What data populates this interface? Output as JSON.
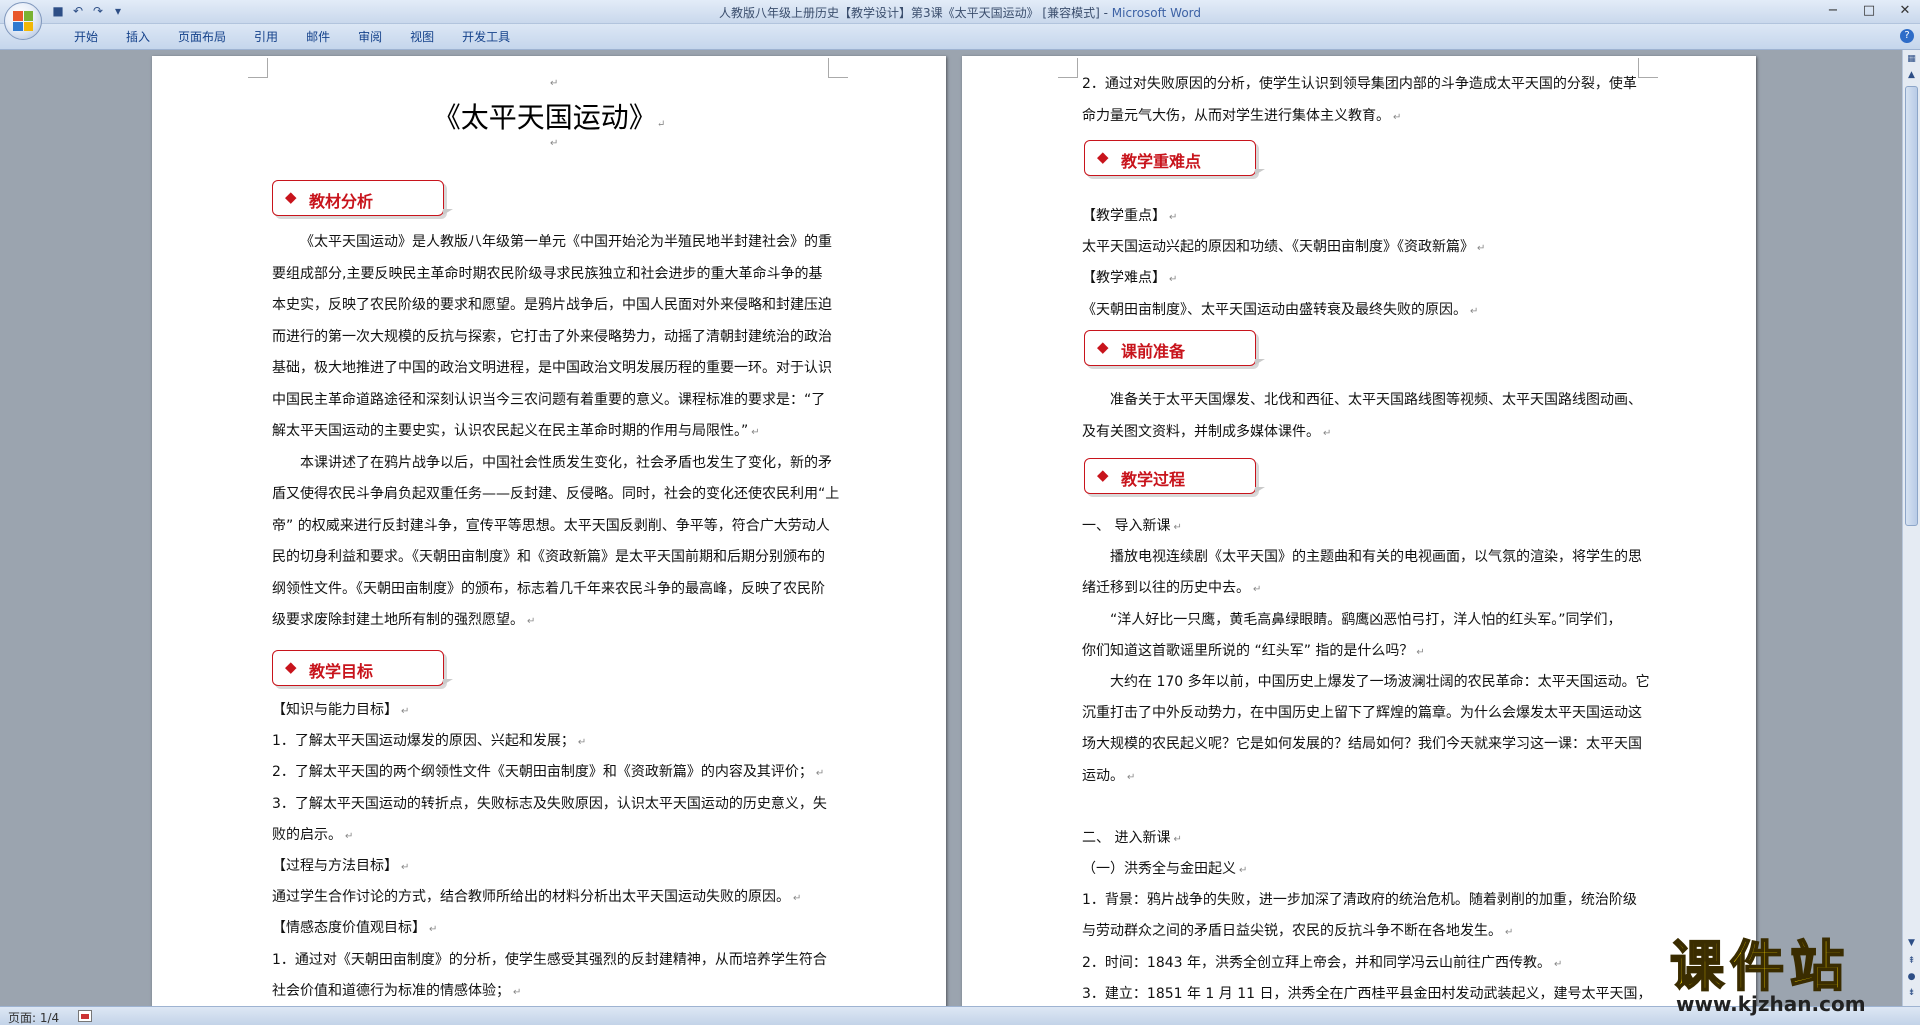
{
  "window": {
    "title_doc": "人教版八年级上册历史【教学设计】第3课《太平天国运动》 [兼容模式] - ",
    "title_app": "Microsoft Word",
    "minimize": "−",
    "maximize": "□",
    "close": "✕"
  },
  "quick_access": [
    "save-icon",
    "undo-icon",
    "redo-icon",
    "customize-icon"
  ],
  "ribbon": {
    "tabs": [
      "开始",
      "插入",
      "页面布局",
      "引用",
      "邮件",
      "审阅",
      "视图",
      "开发工具"
    ],
    "help": "?"
  },
  "page1": {
    "title": "《太平天国运动》",
    "section1": "教材分析",
    "section2": "教学目标",
    "lines": [
      "《太平天国运动》是人教版八年级第一单元《中国开始沦为半殖民地半封建社会》的重",
      "要组成部分,主要反映民主革命时期农民阶级寻求民族独立和社会进步的重大革命斗争的基",
      "本史实，反映了农民阶级的要求和愿望。是鸦片战争后，中国人民面对外来侵略和封建压迫",
      "而进行的第一次大规模的反抗与探索，它打击了外来侵略势力，动摇了清朝封建统治的政治",
      "基础，极大地推进了中国的政治文明进程，是中国政治文明发展历程的重要一环。对于认识",
      "中国民主革命道路途径和深刻认识当今三农问题有着重要的意义。课程标准的要求是：“了",
      "解太平天国运动的主要史实，认识农民起义在民主革命时期的作用与局限性。”",
      "本课讲述了在鸦片战争以后，中国社会性质发生变化，社会矛盾也发生了变化，新的矛",
      "盾又使得农民斗争肩负起双重任务——反封建、反侵略。同时，社会的变化还使农民利用“上",
      "帝” 的权威来进行反封建斗争，宣传平等思想。太平天国反剥削、争平等，符合广大劳动人",
      "民的切身利益和要求。《天朝田亩制度》和《资政新篇》是太平天国前期和后期分别颁布的",
      "纲领性文件。《天朝田亩制度》的颁布，标志着几千年来农民斗争的最高峰，反映了农民阶",
      "级要求废除封建土地所有制的强烈愿望。"
    ],
    "goals": [
      "【知识与能力目标】",
      "1．了解太平天国运动爆发的原因、兴起和发展；",
      "2．了解太平天国的两个纲领性文件《天朝田亩制度》和《资政新篇》的内容及其评价；",
      "3．了解太平天国运动的转折点，失败标志及失败原因，认识太平天国运动的历史意义，失",
      "败的启示。",
      "【过程与方法目标】",
      "通过学生合作讨论的方式，结合教师所给出的材料分析出太平天国运动失败的原因。",
      "【情感态度价值观目标】",
      "1．通过对《天朝田亩制度》的分析，使学生感受其强烈的反封建精神，从而培养学生符合",
      "社会价值和道德行为标准的情感体验；"
    ]
  },
  "page2": {
    "intro": [
      "2．通过对失败原因的分析，使学生认识到领导集团内部的斗争造成太平天国的分裂，使革",
      "命力量元气大伤，从而对学生进行集体主义教育。"
    ],
    "section3": "教学重难点",
    "keypoints": [
      "【教学重点】",
      "太平天国运动兴起的原因和功绩、《天朝田亩制度》《资政新篇》",
      "【教学难点】",
      "《天朝田亩制度》、太平天国运动由盛转衰及最终失败的原因。"
    ],
    "section4": "课前准备",
    "prep": [
      "准备关于太平天国爆发、北伐和西征、太平天国路线图等视频、太平天国路线图动画、",
      "及有关图文资料，并制成多媒体课件。"
    ],
    "section5": "教学过程",
    "process": [
      "一、      导入新课",
      "播放电视连续剧《太平天国》的主题曲和有关的电视画面，以气氛的渲染，将学生的思",
      "绪迁移到以往的历史中去。",
      "“洋人好比一只鹰，黄毛高鼻绿眼睛。鹞鹰凶恶怕弓打，洋人怕的红头军。”同学们，",
      "你们知道这首歌谣里所说的 “红头军” 指的是什么吗？",
      "大约在 170 多年以前，中国历史上爆发了一场波澜壮阔的农民革命：太平天国运动。它",
      "沉重打击了中外反动势力，在中国历史上留下了辉煌的篇章。为什么会爆发太平天国运动这",
      "场大规模的农民起义呢？它是如何发展的？结局如何？我们今天就来学习这一课：太平天国",
      "运动。",
      "二、      进入新课",
      "（一）洪秀全与金田起义",
      "1．背景：鸦片战争的失败，进一步加深了清政府的统治危机。随着剥削的加重，统治阶级",
      "与劳动群众之间的矛盾日益尖锐，农民的反抗斗争不断在各地发生。",
      "2．时间：1843 年，洪秀全创立拜上帝会，并和同学冯云山前往广西传教。",
      "3．建立：1851 年 1 月 11 日，洪秀全在广西桂平县金田村发动武装起义，建号太平天国，"
    ]
  },
  "status": {
    "page": "页面: 1/4"
  },
  "watermark": {
    "text": "课件站",
    "url": "www.kjzhan.com"
  },
  "para_mark": "↵"
}
